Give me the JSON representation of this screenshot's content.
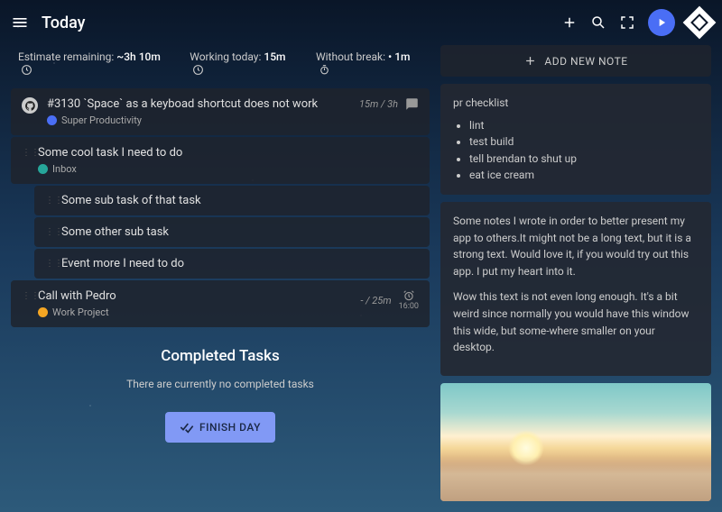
{
  "header": {
    "title": "Today"
  },
  "stats": {
    "estimate_label": "Estimate remaining:",
    "estimate_val": "~3h 10m",
    "working_label": "Working today:",
    "working_val": "15m",
    "break_label": "Without break:",
    "break_val": "• 1m"
  },
  "tasks": [
    {
      "title": "#3130 `Space` as a keyboad shortcut does not work",
      "tag": "Super Productivity",
      "meta": "15m / 3h"
    },
    {
      "title": "Some cool task I need to do",
      "tag": "Inbox"
    },
    {
      "title": "Some sub task of that task"
    },
    {
      "title": "Some other sub task"
    },
    {
      "title": "Event more I need to do"
    },
    {
      "title": "Call with Pedro",
      "tag": "Work Project",
      "meta": "- / 25m",
      "alarm": "16:00"
    }
  ],
  "completed": {
    "heading": "Completed Tasks",
    "empty": "There are currently no completed tasks",
    "finish_label": "FINISH DAY"
  },
  "notes": {
    "add_label": "ADD NEW NOTE",
    "n1_title": "pr checklist",
    "n1_items": [
      "lint",
      "test build",
      "tell brendan to shut up",
      "eat ice cream"
    ],
    "n2_p1": "Some notes I wrote in order to better present my app to others.It might not be a long text, but it is a strong text. Would love it, if you would try out this app. I put my heart into it.",
    "n2_p2": "Wow this text is not even long enough. It's a bit weird since normally you would have this window this wide, but some-where smaller on your desktop."
  }
}
